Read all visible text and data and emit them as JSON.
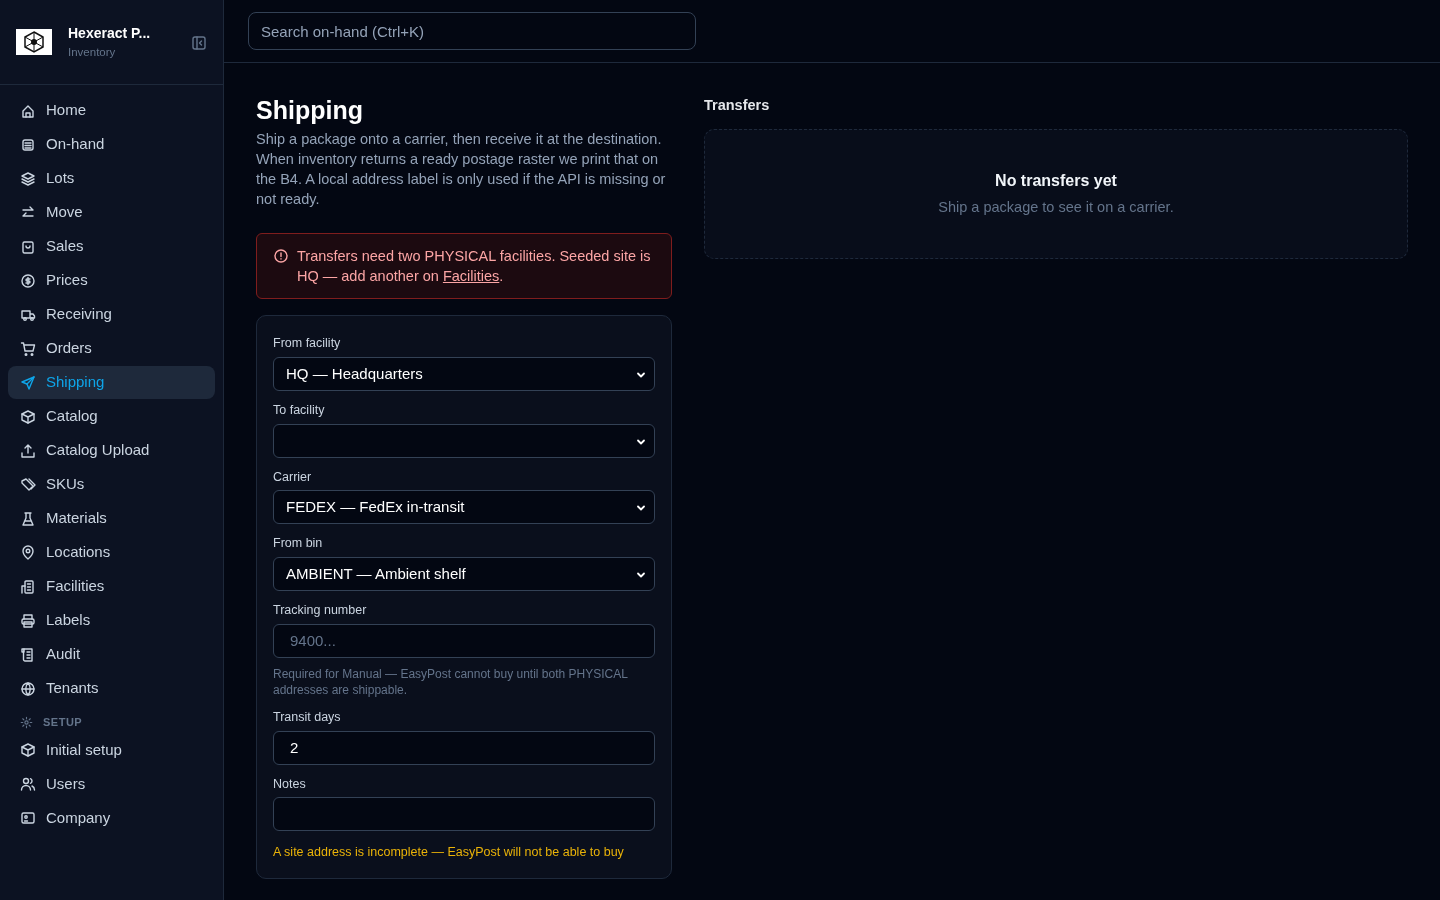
{
  "brand": {
    "title": "Hexeract P...",
    "subtitle": "Inventory"
  },
  "sidebar": {
    "items": [
      {
        "label": "Home",
        "selected": false
      },
      {
        "label": "On-hand",
        "selected": false
      },
      {
        "label": "Lots",
        "selected": false
      },
      {
        "label": "Move",
        "selected": false
      },
      {
        "label": "Sales",
        "selected": false
      },
      {
        "label": "Prices",
        "selected": false
      },
      {
        "label": "Receiving",
        "selected": false
      },
      {
        "label": "Orders",
        "selected": false
      },
      {
        "label": "Shipping",
        "selected": true
      },
      {
        "label": "Catalog",
        "selected": false
      },
      {
        "label": "Catalog Upload",
        "selected": false
      },
      {
        "label": "SKUs",
        "selected": false
      },
      {
        "label": "Materials",
        "selected": false
      },
      {
        "label": "Locations",
        "selected": false
      },
      {
        "label": "Facilities",
        "selected": false
      },
      {
        "label": "Labels",
        "selected": false
      },
      {
        "label": "Audit",
        "selected": false
      },
      {
        "label": "Tenants",
        "selected": false
      }
    ],
    "section": {
      "title": "SETUP",
      "items": [
        {
          "label": "Initial setup",
          "selected": false
        },
        {
          "label": "Users",
          "selected": false
        },
        {
          "label": "Company",
          "selected": false
        }
      ]
    }
  },
  "search": {
    "placeholder": "Search on-hand (Ctrl+K)"
  },
  "page": {
    "title": "Shipping",
    "description": "Ship a package onto a carrier, then receive it at the destination. When inventory returns a ready postage raster we print that on the B4. A local address label is only used if the API is missing or not ready.",
    "alert": {
      "text": "Transfers need two PHYSICAL facilities. Seeded site is HQ — add another on ",
      "link": "Facilities",
      "after": "."
    }
  },
  "form": {
    "fields": [
      {
        "kind": "select",
        "label": "From facility",
        "value": "HQ — Headquarters"
      },
      {
        "kind": "select",
        "label": "To facility"
      },
      {
        "kind": "select",
        "label": "Carrier",
        "value": "FEDEX — FedEx in-transit"
      },
      {
        "kind": "select",
        "label": "From bin",
        "value": "AMBIENT — Ambient shelf"
      },
      {
        "kind": "input",
        "label": "Tracking number",
        "placeholder": "9400...",
        "help": "Required for Manual — EasyPost cannot buy until both PHYSICAL addresses are shippable."
      },
      {
        "kind": "input",
        "label": "Transit days",
        "value": "2"
      },
      {
        "kind": "input",
        "label": "Notes"
      }
    ],
    "warning": "A site address is incomplete — EasyPost will not be able to buy"
  },
  "transfers": {
    "title": "Transfers",
    "empty_title": "No transfers yet",
    "empty_text": "Ship a package to see it on a carrier."
  }
}
